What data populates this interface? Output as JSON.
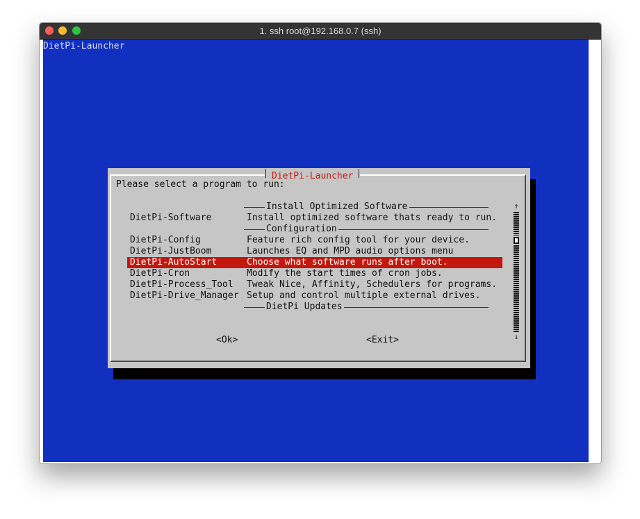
{
  "window": {
    "title": "1. ssh root@192.168.0.7 (ssh)"
  },
  "terminal": {
    "title": "DietPi-Launcher"
  },
  "dialog": {
    "title": "DietPi-Launcher",
    "prompt": "Please select a program to run:",
    "sections": {
      "install": "Install Optimized Software",
      "configuration": "Configuration",
      "updates": "DietPi Updates"
    },
    "items": [
      {
        "name": "DietPi-Software",
        "desc": "Install optimized software thats ready to run."
      },
      {
        "name": "DietPi-Config",
        "desc": "Feature rich config tool for your device."
      },
      {
        "name": "DietPi-JustBoom",
        "desc": "Launches EQ and MPD audio options menu"
      },
      {
        "name": "DietPi-AutoStart",
        "desc": "Choose what software runs after boot."
      },
      {
        "name": "DietPi-Cron",
        "desc": "Modify the start times of cron jobs."
      },
      {
        "name": "DietPi-Process_Tool",
        "desc": "Tweak Nice, Affinity, Schedulers for programs."
      },
      {
        "name": "DietPi-Drive_Manager",
        "desc": "Setup and control multiple external drives."
      }
    ],
    "selected_index": 3,
    "scroll": {
      "up": "↑",
      "down": "↓"
    },
    "buttons": {
      "ok": "<Ok>",
      "exit": "<Exit>"
    }
  },
  "colors": {
    "terminal_bg": "#1230c0",
    "dialog_bg": "#c6c6c6",
    "selection_bg": "#c4180e",
    "title_text": "#c31a0e",
    "titlebar": "#343434"
  }
}
